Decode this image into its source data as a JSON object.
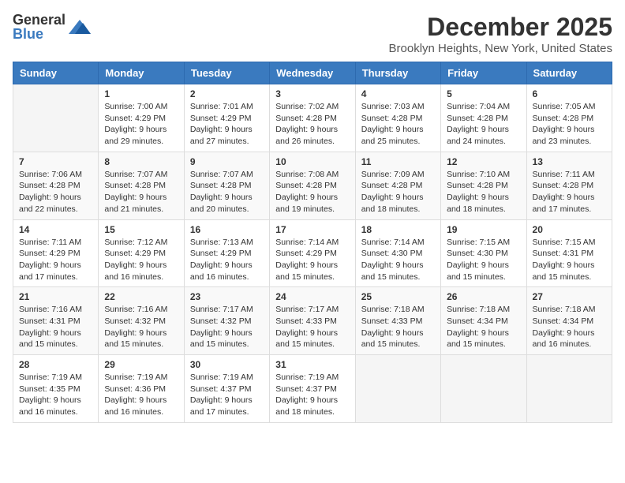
{
  "header": {
    "logo_general": "General",
    "logo_blue": "Blue",
    "title": "December 2025",
    "subtitle": "Brooklyn Heights, New York, United States"
  },
  "calendar": {
    "days_of_week": [
      "Sunday",
      "Monday",
      "Tuesday",
      "Wednesday",
      "Thursday",
      "Friday",
      "Saturday"
    ],
    "weeks": [
      [
        {
          "day": "",
          "info": ""
        },
        {
          "day": "1",
          "info": "Sunrise: 7:00 AM\nSunset: 4:29 PM\nDaylight: 9 hours\nand 29 minutes."
        },
        {
          "day": "2",
          "info": "Sunrise: 7:01 AM\nSunset: 4:29 PM\nDaylight: 9 hours\nand 27 minutes."
        },
        {
          "day": "3",
          "info": "Sunrise: 7:02 AM\nSunset: 4:28 PM\nDaylight: 9 hours\nand 26 minutes."
        },
        {
          "day": "4",
          "info": "Sunrise: 7:03 AM\nSunset: 4:28 PM\nDaylight: 9 hours\nand 25 minutes."
        },
        {
          "day": "5",
          "info": "Sunrise: 7:04 AM\nSunset: 4:28 PM\nDaylight: 9 hours\nand 24 minutes."
        },
        {
          "day": "6",
          "info": "Sunrise: 7:05 AM\nSunset: 4:28 PM\nDaylight: 9 hours\nand 23 minutes."
        }
      ],
      [
        {
          "day": "7",
          "info": "Sunrise: 7:06 AM\nSunset: 4:28 PM\nDaylight: 9 hours\nand 22 minutes."
        },
        {
          "day": "8",
          "info": "Sunrise: 7:07 AM\nSunset: 4:28 PM\nDaylight: 9 hours\nand 21 minutes."
        },
        {
          "day": "9",
          "info": "Sunrise: 7:07 AM\nSunset: 4:28 PM\nDaylight: 9 hours\nand 20 minutes."
        },
        {
          "day": "10",
          "info": "Sunrise: 7:08 AM\nSunset: 4:28 PM\nDaylight: 9 hours\nand 19 minutes."
        },
        {
          "day": "11",
          "info": "Sunrise: 7:09 AM\nSunset: 4:28 PM\nDaylight: 9 hours\nand 18 minutes."
        },
        {
          "day": "12",
          "info": "Sunrise: 7:10 AM\nSunset: 4:28 PM\nDaylight: 9 hours\nand 18 minutes."
        },
        {
          "day": "13",
          "info": "Sunrise: 7:11 AM\nSunset: 4:28 PM\nDaylight: 9 hours\nand 17 minutes."
        }
      ],
      [
        {
          "day": "14",
          "info": "Sunrise: 7:11 AM\nSunset: 4:29 PM\nDaylight: 9 hours\nand 17 minutes."
        },
        {
          "day": "15",
          "info": "Sunrise: 7:12 AM\nSunset: 4:29 PM\nDaylight: 9 hours\nand 16 minutes."
        },
        {
          "day": "16",
          "info": "Sunrise: 7:13 AM\nSunset: 4:29 PM\nDaylight: 9 hours\nand 16 minutes."
        },
        {
          "day": "17",
          "info": "Sunrise: 7:14 AM\nSunset: 4:29 PM\nDaylight: 9 hours\nand 15 minutes."
        },
        {
          "day": "18",
          "info": "Sunrise: 7:14 AM\nSunset: 4:30 PM\nDaylight: 9 hours\nand 15 minutes."
        },
        {
          "day": "19",
          "info": "Sunrise: 7:15 AM\nSunset: 4:30 PM\nDaylight: 9 hours\nand 15 minutes."
        },
        {
          "day": "20",
          "info": "Sunrise: 7:15 AM\nSunset: 4:31 PM\nDaylight: 9 hours\nand 15 minutes."
        }
      ],
      [
        {
          "day": "21",
          "info": "Sunrise: 7:16 AM\nSunset: 4:31 PM\nDaylight: 9 hours\nand 15 minutes."
        },
        {
          "day": "22",
          "info": "Sunrise: 7:16 AM\nSunset: 4:32 PM\nDaylight: 9 hours\nand 15 minutes."
        },
        {
          "day": "23",
          "info": "Sunrise: 7:17 AM\nSunset: 4:32 PM\nDaylight: 9 hours\nand 15 minutes."
        },
        {
          "day": "24",
          "info": "Sunrise: 7:17 AM\nSunset: 4:33 PM\nDaylight: 9 hours\nand 15 minutes."
        },
        {
          "day": "25",
          "info": "Sunrise: 7:18 AM\nSunset: 4:33 PM\nDaylight: 9 hours\nand 15 minutes."
        },
        {
          "day": "26",
          "info": "Sunrise: 7:18 AM\nSunset: 4:34 PM\nDaylight: 9 hours\nand 15 minutes."
        },
        {
          "day": "27",
          "info": "Sunrise: 7:18 AM\nSunset: 4:34 PM\nDaylight: 9 hours\nand 16 minutes."
        }
      ],
      [
        {
          "day": "28",
          "info": "Sunrise: 7:19 AM\nSunset: 4:35 PM\nDaylight: 9 hours\nand 16 minutes."
        },
        {
          "day": "29",
          "info": "Sunrise: 7:19 AM\nSunset: 4:36 PM\nDaylight: 9 hours\nand 16 minutes."
        },
        {
          "day": "30",
          "info": "Sunrise: 7:19 AM\nSunset: 4:37 PM\nDaylight: 9 hours\nand 17 minutes."
        },
        {
          "day": "31",
          "info": "Sunrise: 7:19 AM\nSunset: 4:37 PM\nDaylight: 9 hours\nand 18 minutes."
        },
        {
          "day": "",
          "info": ""
        },
        {
          "day": "",
          "info": ""
        },
        {
          "day": "",
          "info": ""
        }
      ]
    ]
  }
}
